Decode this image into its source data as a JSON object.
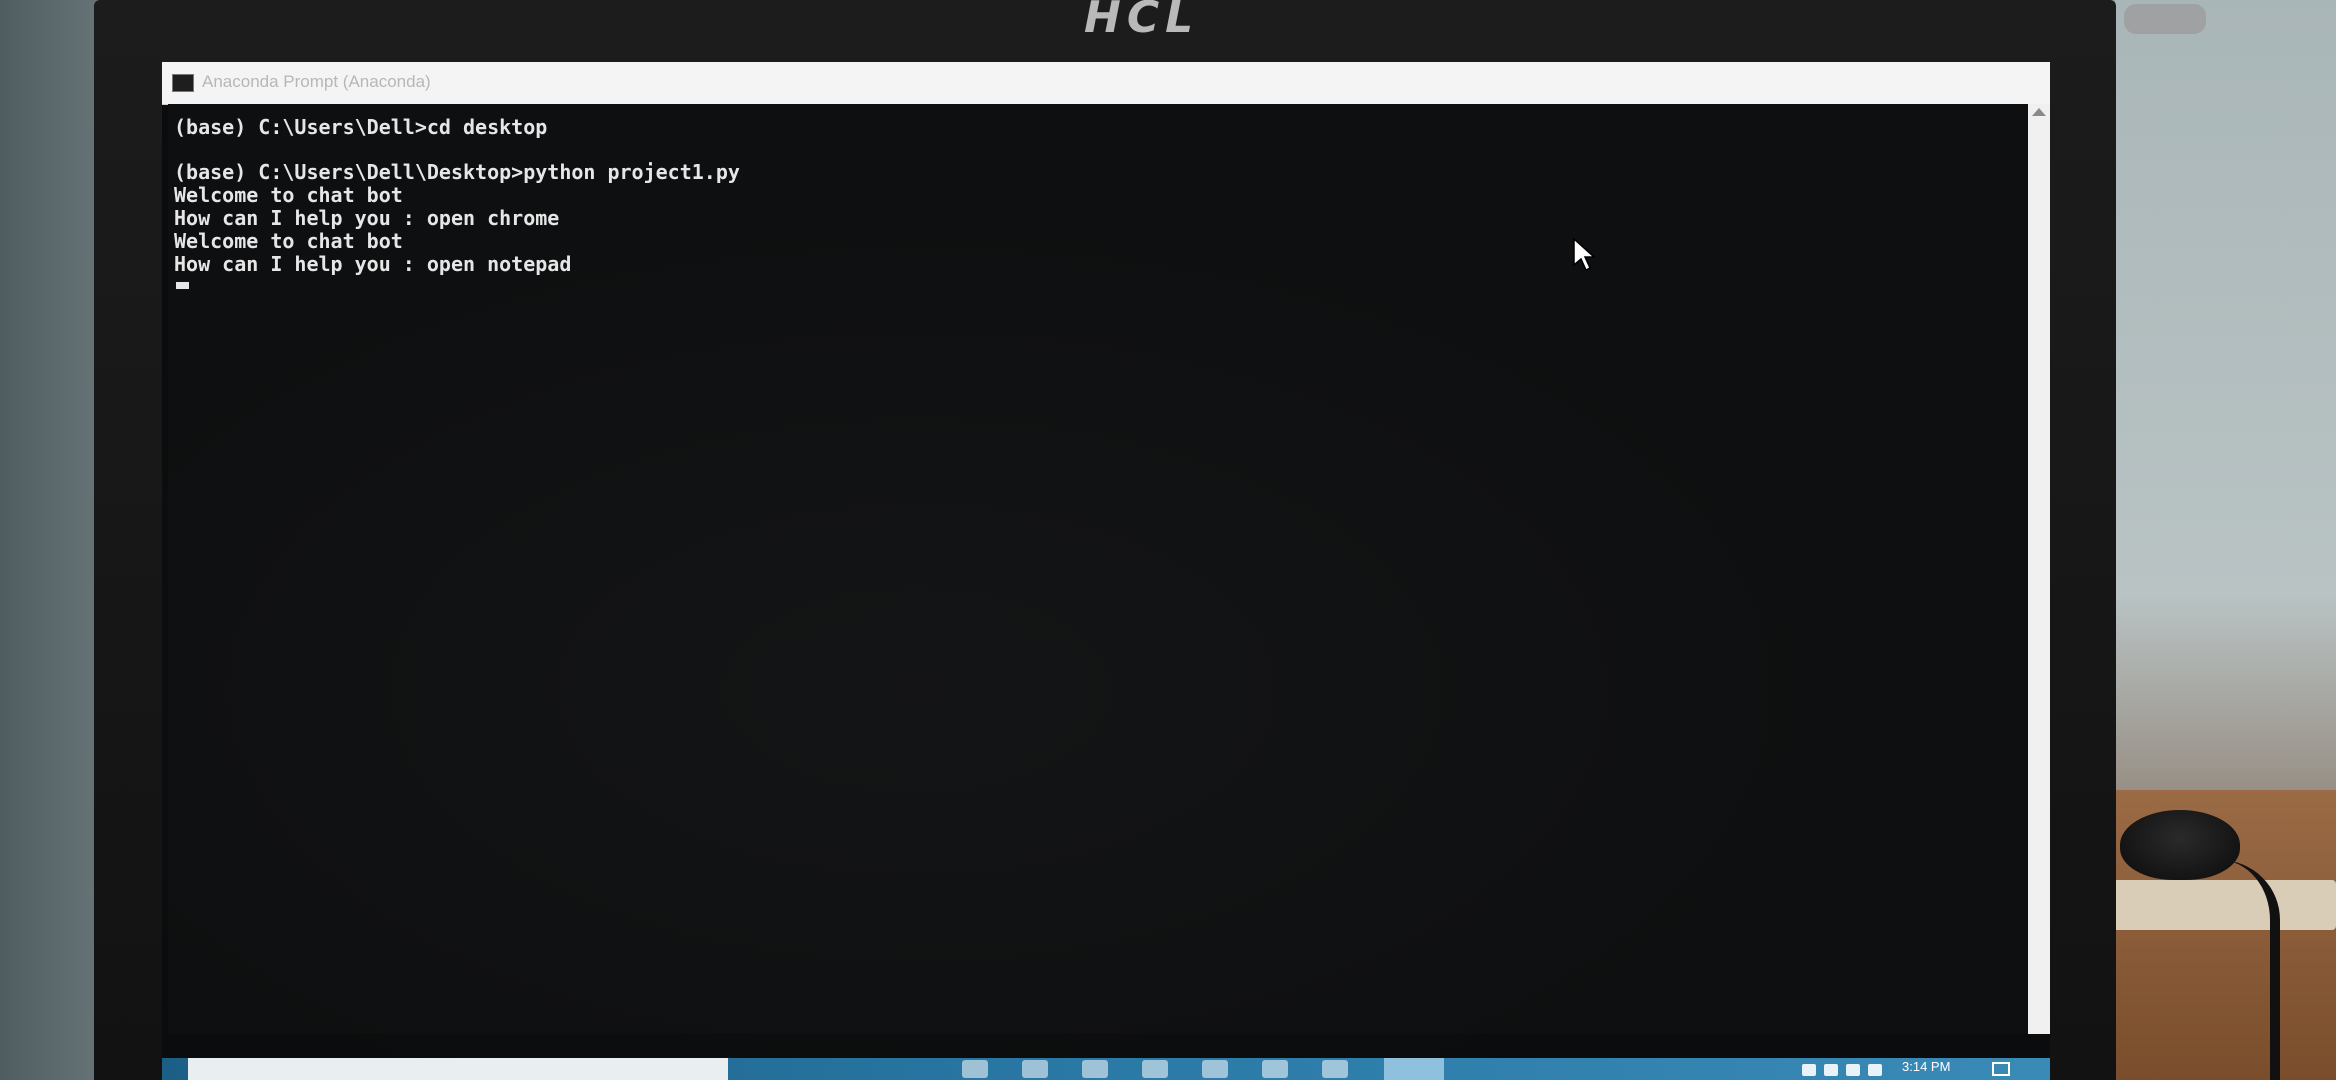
{
  "monitor": {
    "brand": "HCL"
  },
  "window": {
    "title": "Anaconda Prompt (Anaconda)",
    "icon": "console-icon"
  },
  "console": {
    "lines": [
      "(base) C:\\Users\\Dell>cd desktop",
      "",
      "(base) C:\\Users\\Dell\\Desktop>python project1.py",
      "Welcome to chat bot",
      "How can I help you : open chrome",
      "Welcome to chat bot",
      "How can I help you : open notepad"
    ]
  },
  "taskbar": {
    "clock": "3:14 PM",
    "icons": [
      "start-icon",
      "search-icon",
      "file-explorer-icon",
      "chrome-icon",
      "store-icon",
      "mail-icon",
      "photos-icon",
      "settings-icon",
      "terminal-icon"
    ]
  },
  "colors": {
    "console_bg": "#0e0f10",
    "console_text": "#e6e6e6",
    "taskbar": "#2a79a6"
  }
}
